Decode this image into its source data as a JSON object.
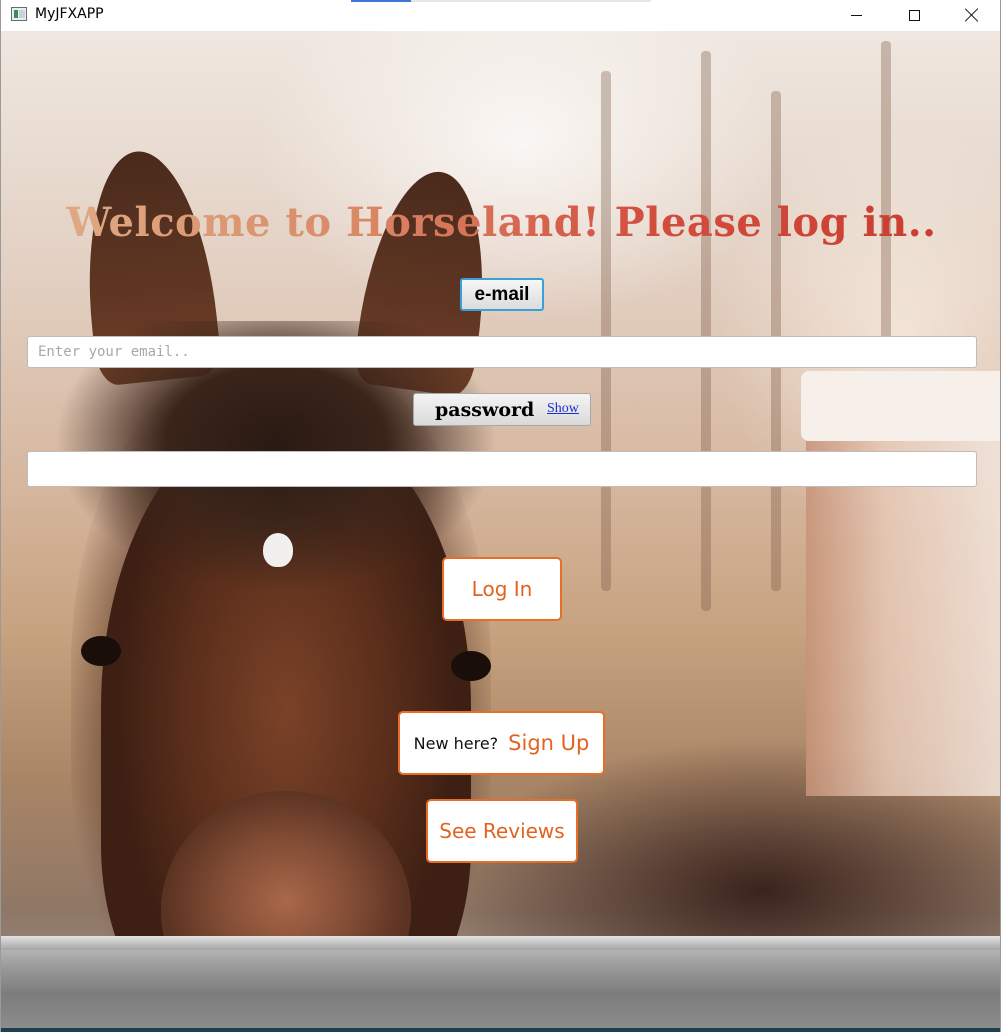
{
  "window": {
    "title": "MyJFXAPP",
    "controls": {
      "minimize_icon": "minimize-icon",
      "maximize_icon": "maximize-icon",
      "close_icon": "close-icon"
    }
  },
  "login": {
    "heading": "Welcome to Horseland! Please log in..",
    "email_label": "e-mail",
    "email_placeholder": "Enter your email..",
    "email_value": "",
    "password_label": "password",
    "password_show": "Show",
    "password_value": "",
    "login_button": "Log In",
    "signup_prompt": "New here?",
    "signup_button": "Sign Up",
    "reviews_button": "See Reviews"
  },
  "colors": {
    "accent": "#e66f27",
    "email_focus": "#3aa0d8",
    "link": "#1a2fd0",
    "heading_start": "#e0b08a",
    "heading_end": "#c73a2c"
  }
}
